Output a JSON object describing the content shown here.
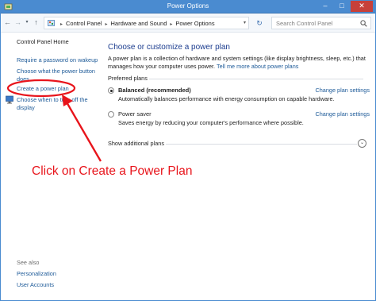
{
  "window": {
    "title": "Power Options",
    "controls": {
      "minimize": "–",
      "maximize": "□",
      "close": "✕"
    },
    "accent": "#4a8bd0",
    "close_color": "#c7403a"
  },
  "address_bar": {
    "nav": {
      "back": "←",
      "forward": "→",
      "recent": "▾",
      "up": "↑"
    },
    "breadcrumb": [
      "Control Panel",
      "Hardware and Sound",
      "Power Options"
    ],
    "separator": "▸",
    "dropdown": "▾",
    "refresh": "↻",
    "search_placeholder": "Search Control Panel"
  },
  "sidebar": {
    "home": "Control Panel Home",
    "links": [
      "Require a password on wakeup",
      "Choose what the power button does",
      "Create a power plan",
      "Choose when to turn off the display"
    ],
    "see_also_label": "See also",
    "see_also": [
      "Personalization",
      "User Accounts"
    ]
  },
  "main": {
    "heading": "Choose or customize a power plan",
    "description": "A power plan is a collection of hardware and system settings (like display brightness, sleep, etc.) that manages how your computer uses power.",
    "description_link": "Tell me more about power plans",
    "preferred_label": "Preferred plans",
    "plans": [
      {
        "name": "Balanced (recommended)",
        "desc": "Automatically balances performance with energy consumption on capable hardware.",
        "link": "Change plan settings",
        "selected": true
      },
      {
        "name": "Power saver",
        "desc": "Saves energy by reducing your computer's performance where possible.",
        "link": "Change plan settings",
        "selected": false
      }
    ],
    "show_additional": "Show additional plans",
    "expander_icon": "chevron-down-icon"
  },
  "annotation": {
    "text": "Click on Create a Power Plan",
    "color": "#e8141b"
  }
}
